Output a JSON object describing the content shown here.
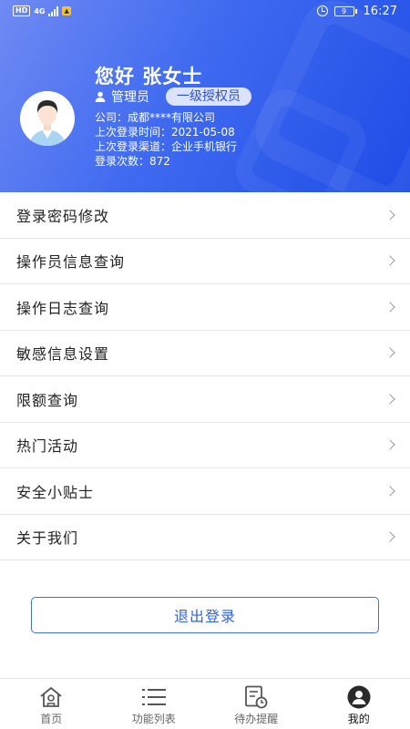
{
  "status_bar": {
    "hd": "HD",
    "network": "4G",
    "time": "16:27",
    "battery": "9"
  },
  "profile": {
    "greeting": "您好 张女士",
    "role": "管理员",
    "level": "一级授权员",
    "company": "公司：成都****有限公司",
    "last_login_time": "上次登录时间：2021-05-08",
    "last_login_channel": "上次登录渠道：企业手机银行",
    "login_count": "登录次数：872"
  },
  "menu": [
    {
      "label": "登录密码修改"
    },
    {
      "label": "操作员信息查询"
    },
    {
      "label": "操作日志查询"
    },
    {
      "label": "敏感信息设置"
    },
    {
      "label": "限额查询"
    },
    {
      "label": "热门活动"
    },
    {
      "label": "安全小贴士"
    },
    {
      "label": "关于我们"
    }
  ],
  "logout_label": "退出登录",
  "bottom_nav": [
    {
      "label": "首页",
      "icon": "home-icon"
    },
    {
      "label": "功能列表",
      "icon": "list-icon"
    },
    {
      "label": "待办提醒",
      "icon": "todo-icon"
    },
    {
      "label": "我的",
      "icon": "profile-icon",
      "active": true
    }
  ],
  "colors": {
    "header_start": "#6f8af3",
    "header_end": "#1f4ce6",
    "accent": "#2f62e8"
  }
}
